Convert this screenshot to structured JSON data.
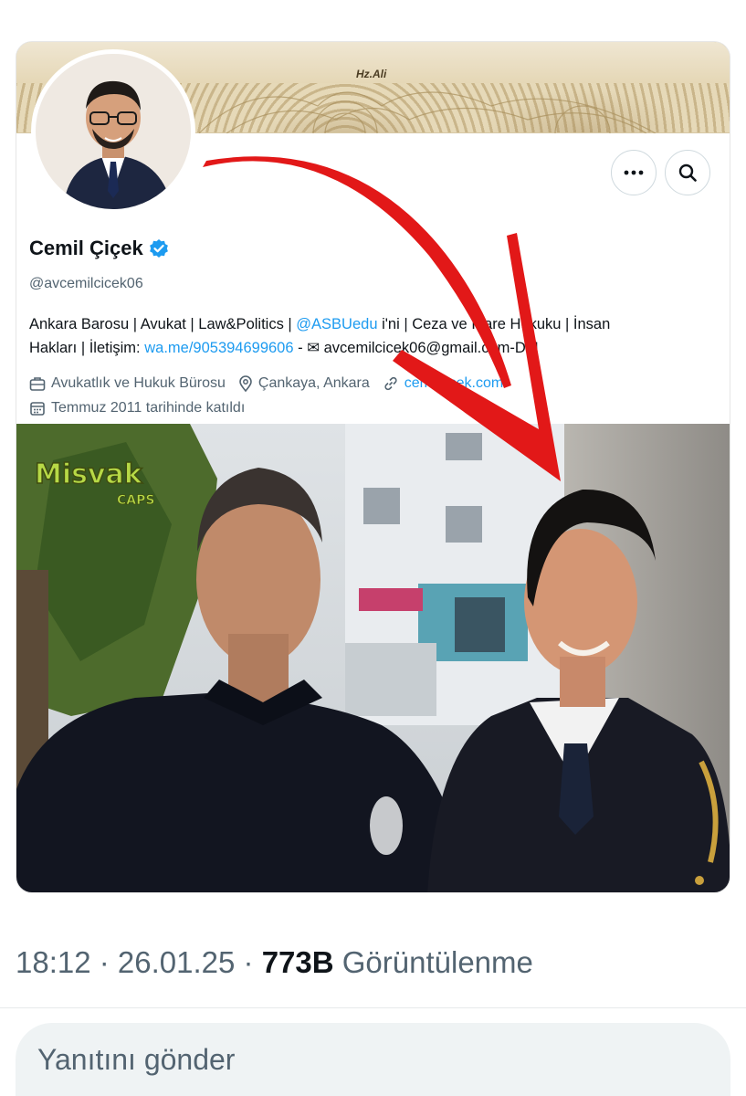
{
  "profile": {
    "banner_caption": "Hz.Ali",
    "name": "Cemil Çiçek",
    "handle": "@avcemilcicek06",
    "bio_line1_a": "Ankara Barosu | Avukat | Law&Politics | ",
    "bio_line1_link": "@ASBUedu",
    "bio_line1_b": " i'ni | Ceza ve İdare Hukuku | İnsan",
    "bio_line2_a": "Hakları | İletişim: ",
    "bio_line2_link": "wa.me/905394699606",
    "bio_line2_b": " - ✉ avcemilcic⁠ek06@gmail.com-DM",
    "category": "Avukatlık ve Hukuk Bürosu",
    "location": "Çankaya, Ankara",
    "website": "cemilcicek.com",
    "joined": "Temmuz 2011 tarihinde katıldı"
  },
  "photo": {
    "watermark_top": "Misvak",
    "watermark_bottom": "CAPS"
  },
  "tweet": {
    "time": "18:12 · 26.01.25 · ",
    "views_count": "773B",
    "views_label": " Görüntülenme"
  },
  "reply": {
    "placeholder": "Yanıtını gönder"
  },
  "colors": {
    "accent": "#1d9bf0",
    "arrow": "#e21818",
    "muted_text": "#536471"
  }
}
